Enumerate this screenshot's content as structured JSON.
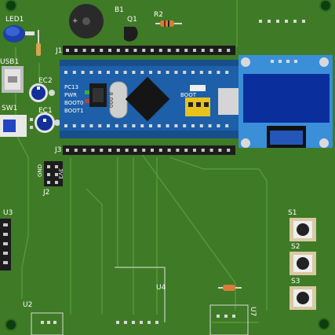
{
  "board": {
    "color": "#3f7a26",
    "trace_color": "#4b8a31",
    "edge_color": "#2a5c1a"
  },
  "designators": {
    "led1": "LED1",
    "usb1": "USB1",
    "sw1": "SW1",
    "ec2": "EC2",
    "ec1": "EC1",
    "b1": "B1",
    "q1": "Q1",
    "r2": "R2",
    "j1": "J1",
    "j3": "J3",
    "j2": "J2",
    "u3": "U3",
    "u2": "U2",
    "u4": "U4",
    "u7": "U7",
    "s1": "S1",
    "s2": "S2",
    "s3": "S3"
  },
  "j2_pins": {
    "gnd": "GND",
    "pwr": "3V3"
  },
  "mcu_board": {
    "chip_label": "8.000",
    "indicator_labels": [
      "PC13",
      "PWR",
      "BOOT0",
      "BOOT1"
    ],
    "jumper_label": "BOOT",
    "board_color": "#1d5fa8"
  },
  "oled": {
    "screen_color": "#0a2f9c",
    "frame_color": "#3a8fd8"
  }
}
